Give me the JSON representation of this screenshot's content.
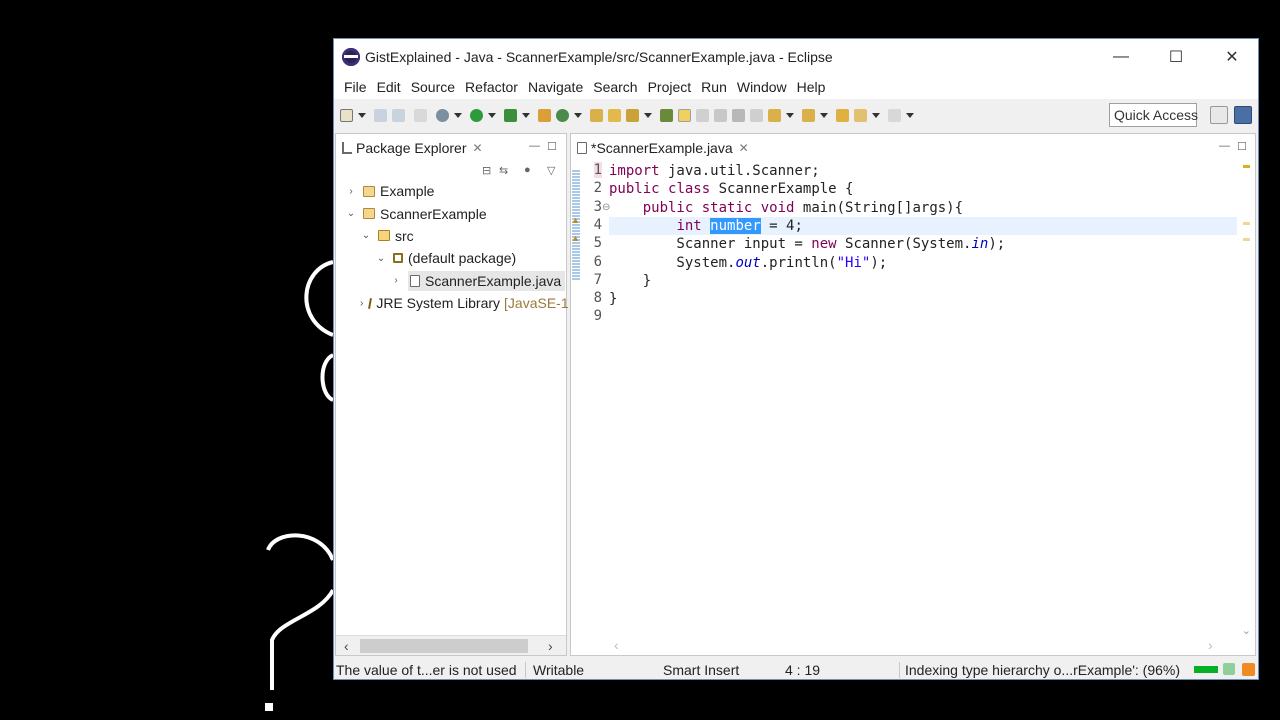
{
  "window": {
    "title": "GistExplained - Java - ScannerExample/src/ScannerExample.java - Eclipse",
    "buttons": {
      "minimize": "—",
      "maximize": "☐",
      "close": "✕"
    }
  },
  "menu": [
    "File",
    "Edit",
    "Source",
    "Refactor",
    "Navigate",
    "Search",
    "Project",
    "Run",
    "Window",
    "Help"
  ],
  "toolbar": {
    "quick_access": "Quick Access"
  },
  "package_explorer": {
    "title": "Package Explorer",
    "tree": [
      {
        "label": "Example",
        "indent": 0,
        "twisty": "›",
        "icon": "project-icon"
      },
      {
        "label": "ScannerExample",
        "indent": 0,
        "twisty": "⌄",
        "icon": "project-icon"
      },
      {
        "label": "src",
        "indent": 1,
        "twisty": "⌄",
        "icon": "source-folder-icon"
      },
      {
        "label": "(default package)",
        "indent": 2,
        "twisty": "⌄",
        "icon": "package-icon"
      },
      {
        "label": "ScannerExample.java",
        "indent": 3,
        "twisty": "›",
        "icon": "java-file-icon",
        "selected": true
      },
      {
        "label": "JRE System Library",
        "suffix": "[JavaSE-1",
        "indent": 1,
        "twisty": "›",
        "icon": "library-icon"
      }
    ]
  },
  "editor": {
    "tab_label": "*ScannerExample.java",
    "line_numbers": [
      "1",
      "2",
      "3",
      "4",
      "5",
      "6",
      "7",
      "8",
      "9"
    ],
    "lines": [
      [
        {
          "t": "import",
          "c": "kw"
        },
        {
          "t": " java.util.Scanner;",
          "c": ""
        }
      ],
      [
        {
          "t": "public",
          "c": "kw"
        },
        {
          "t": " ",
          "c": ""
        },
        {
          "t": "class",
          "c": "kw"
        },
        {
          "t": " ScannerExample {",
          "c": ""
        }
      ],
      [
        {
          "t": "    ",
          "c": ""
        },
        {
          "t": "public",
          "c": "kw"
        },
        {
          "t": " ",
          "c": ""
        },
        {
          "t": "static",
          "c": "kw"
        },
        {
          "t": " ",
          "c": ""
        },
        {
          "t": "void",
          "c": "kw"
        },
        {
          "t": " main(String[]args){",
          "c": ""
        }
      ],
      [
        {
          "t": "        ",
          "c": ""
        },
        {
          "t": "int",
          "c": "kw"
        },
        {
          "t": " ",
          "c": ""
        },
        {
          "t": "number",
          "c": "sel"
        },
        {
          "t": " = 4;",
          "c": ""
        }
      ],
      [
        {
          "t": "        Scanner input = ",
          "c": ""
        },
        {
          "t": "new",
          "c": "kw"
        },
        {
          "t": " Scanner(System.",
          "c": ""
        },
        {
          "t": "in",
          "c": "fld"
        },
        {
          "t": ");",
          "c": ""
        }
      ],
      [
        {
          "t": "        System.",
          "c": ""
        },
        {
          "t": "out",
          "c": "fld"
        },
        {
          "t": ".println(",
          "c": ""
        },
        {
          "t": "\"Hi\"",
          "c": "str"
        },
        {
          "t": ");",
          "c": ""
        }
      ],
      [
        {
          "t": "    }",
          "c": ""
        }
      ],
      [
        {
          "t": "}",
          "c": ""
        }
      ],
      [
        {
          "t": "",
          "c": ""
        }
      ]
    ]
  },
  "status": {
    "message": "The value of t...er is not used",
    "mode": "Writable",
    "insert": "Smart Insert",
    "position": "4 : 19",
    "job": "Indexing type hierarchy o...rExample': (96%)",
    "job_progress": 0.96
  },
  "colors": {
    "keyword": "#7f0055",
    "string": "#2a00ff",
    "field": "#0000c0",
    "selection": "#3399ff",
    "current_line": "#e8f2fe"
  }
}
